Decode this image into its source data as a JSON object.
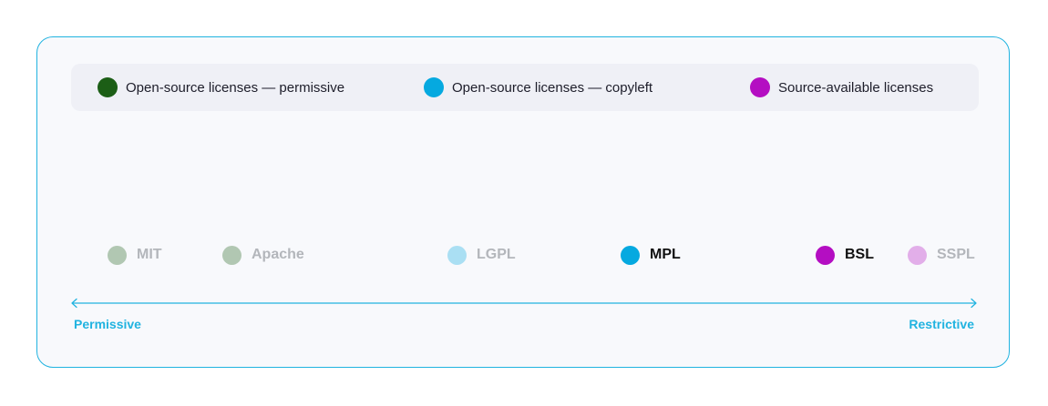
{
  "legend": {
    "items": [
      {
        "label": "Open-source licenses — permissive",
        "color": "#1c5e16"
      },
      {
        "label": "Open-source licenses — copyleft",
        "color": "#05a9e0"
      },
      {
        "label": "Source-available licenses",
        "color": "#b40ec2"
      }
    ]
  },
  "licenses": [
    {
      "label": "MIT",
      "category": "permissive",
      "color": "#1c5e16",
      "highlighted": false
    },
    {
      "label": "Apache",
      "category": "permissive",
      "color": "#1c5e16",
      "highlighted": false
    },
    {
      "label": "LGPL",
      "category": "copyleft",
      "color": "#05a9e0",
      "highlighted": false
    },
    {
      "label": "MPL",
      "category": "copyleft",
      "color": "#05a9e0",
      "highlighted": true
    },
    {
      "label": "BSL",
      "category": "source-available",
      "color": "#b40ec2",
      "highlighted": true
    },
    {
      "label": "SSPL",
      "category": "source-available",
      "color": "#b40ec2",
      "highlighted": false
    }
  ],
  "axis": {
    "left_label": "Permissive",
    "right_label": "Restrictive",
    "color": "#21b3e0"
  }
}
